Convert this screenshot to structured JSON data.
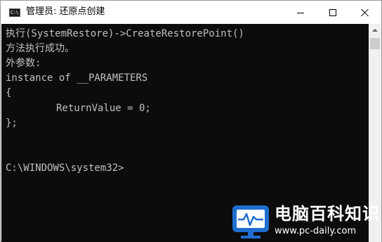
{
  "window": {
    "title": "管理员: 还原点创建",
    "icon": "console-icon",
    "controls": {
      "minimize": "minimize-icon",
      "maximize": "maximize-icon",
      "close": "close-icon"
    }
  },
  "console": {
    "lines": [
      "执行(SystemRestore)->CreateRestorePoint()",
      "方法执行成功。",
      "外参数:",
      "instance of __PARAMETERS",
      "{",
      "ReturnValue = 0;",
      "};",
      "C:\\WINDOWS\\system32>"
    ],
    "background_color": "#0c0c0c",
    "text_color": "#c0c0c0"
  },
  "watermark": {
    "title": "电脑百科知识",
    "url": "www.pc-daily.com",
    "accent_color": "#1e6fd0"
  }
}
